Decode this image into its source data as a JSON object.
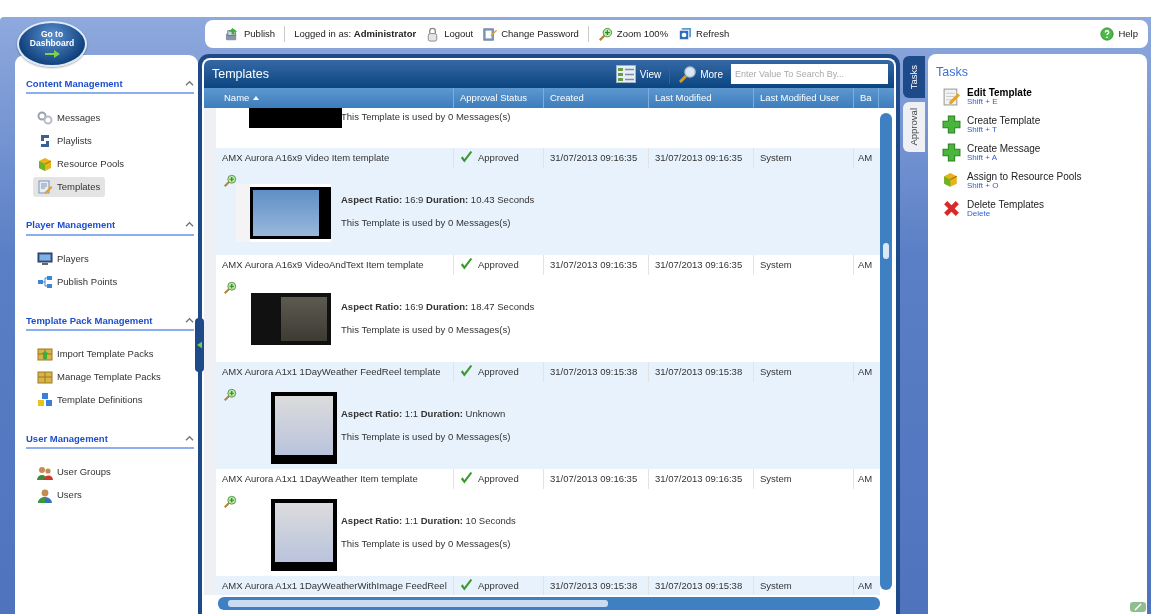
{
  "logo": {
    "label": "Go to Dashboard"
  },
  "toolbar": {
    "items": [
      {
        "kind": "button",
        "label": "Publish"
      },
      {
        "kind": "separator"
      },
      {
        "kind": "text",
        "label": "Logged in as: **Administrator**"
      },
      {
        "kind": "button",
        "label": "Logout"
      },
      {
        "kind": "button",
        "label": "Change Password"
      },
      {
        "kind": "separator"
      },
      {
        "kind": "button",
        "label": "Zoom 100%"
      },
      {
        "kind": "button",
        "label": "Refresh"
      }
    ],
    "help": "Help"
  },
  "sidebar": {
    "sections": [
      {
        "title": "Content Management",
        "expanded": true,
        "items": [
          {
            "label": "Messages",
            "selected": false
          },
          {
            "label": "Playlists",
            "selected": false
          },
          {
            "label": "Resource Pools",
            "selected": false
          },
          {
            "label": "Templates",
            "selected": true
          }
        ]
      },
      {
        "title": "Player Management",
        "expanded": true,
        "items": [
          {
            "label": "Players",
            "selected": false
          },
          {
            "label": "Publish Points",
            "selected": false
          }
        ]
      },
      {
        "title": "Template Pack Management",
        "expanded": true,
        "items": [
          {
            "label": "Import Template Packs",
            "selected": false
          },
          {
            "label": "Manage Template Packs",
            "selected": false
          },
          {
            "label": "Template Definitions",
            "selected": false
          }
        ]
      },
      {
        "title": "User Management",
        "expanded": true,
        "items": [
          {
            "label": "User Groups",
            "selected": false
          },
          {
            "label": "Users",
            "selected": false
          }
        ]
      }
    ]
  },
  "templates": {
    "title": "Templates",
    "view": "View",
    "more": "More",
    "search": {
      "placeholder": "Enter Value To Search By..."
    },
    "columns": [
      {
        "label": "Name",
        "sorted": true
      },
      {
        "label": "Approval Status",
        "sorted": false
      },
      {
        "label": "Created",
        "sorted": false
      },
      {
        "label": "Last Modified",
        "sorted": false
      },
      {
        "label": "Last Modified User",
        "sorted": false
      },
      {
        "label": "Ba",
        "sorted": false
      }
    ],
    "rows": [
      {
        "details": {
          "kind": "cut",
          "usage": "This Template is used by 0 Messages(s)"
        }
      },
      {
        "name": "AMX Aurora A16x9 Video Item template",
        "status": "Approved",
        "created": "31/07/2013 09:16:35",
        "modified": "31/07/2013 09:16:35",
        "user": "System",
        "column_6": "AM",
        "details": {
          "kind": "photo",
          "summary": "**Aspect Ratio:** 16:9  **Duration:** 10.43 Seconds",
          "usage": "This Template is used by 0 Messages(s)"
        }
      },
      {
        "name": "AMX Aurora A16x9 VideoAndText Item template",
        "status": "Approved",
        "created": "31/07/2013 09:16:35",
        "modified": "31/07/2013 09:16:35",
        "user": "System",
        "column_6": "AM",
        "details": {
          "kind": "text",
          "summary": "**Aspect Ratio:** 16:9  **Duration:** 18.47 Seconds",
          "usage": "This Template is used by 0 Messages(s)"
        }
      },
      {
        "name": "AMX Aurora A1x1 1DayWeather FeedReel template",
        "status": "Approved",
        "created": "31/07/2013 09:15:38",
        "modified": "31/07/2013 09:15:38",
        "user": "System",
        "column_6": "AM",
        "details": {
          "kind": "square",
          "summary": "**Aspect Ratio:** 1:1  **Duration:** Unknown",
          "usage": "This Template is used by 0 Messages(s)"
        }
      },
      {
        "name": "AMX Aurora A1x1 1DayWeather Item template",
        "status": "Approved",
        "created": "31/07/2013 09:16:35",
        "modified": "31/07/2013 09:16:35",
        "user": "System",
        "column_6": "AM",
        "details": {
          "kind": "square",
          "summary": "**Aspect Ratio:** 1:1  **Duration:** 10 Seconds",
          "usage": "This Template is used by 0 Messages(s)"
        }
      },
      {
        "name": "AMX Aurora A1x1 1DayWeatherWithImage FeedReel",
        "status": "Approved",
        "created": "31/07/2013 09:15:38",
        "modified": "31/07/2013 09:15:38",
        "user": "System",
        "column_6": "AM"
      }
    ]
  },
  "side_tabs": [
    {
      "label": "Tasks",
      "selected": true
    },
    {
      "label": "Approval",
      "selected": false
    }
  ],
  "tasks": {
    "title": "Tasks",
    "items": [
      {
        "label": "Edit Template",
        "shortcut": "Shift + E",
        "highlighted": true
      },
      {
        "label": "Create Template",
        "shortcut": "Shift + T",
        "highlighted": false
      },
      {
        "label": "Create Message",
        "shortcut": "Shift + A",
        "highlighted": false
      },
      {
        "label": "Assign to Resource Pools",
        "shortcut": "Shift + O",
        "highlighted": false
      },
      {
        "label": "Delete Templates",
        "shortcut": "Delete",
        "highlighted": false
      }
    ]
  }
}
